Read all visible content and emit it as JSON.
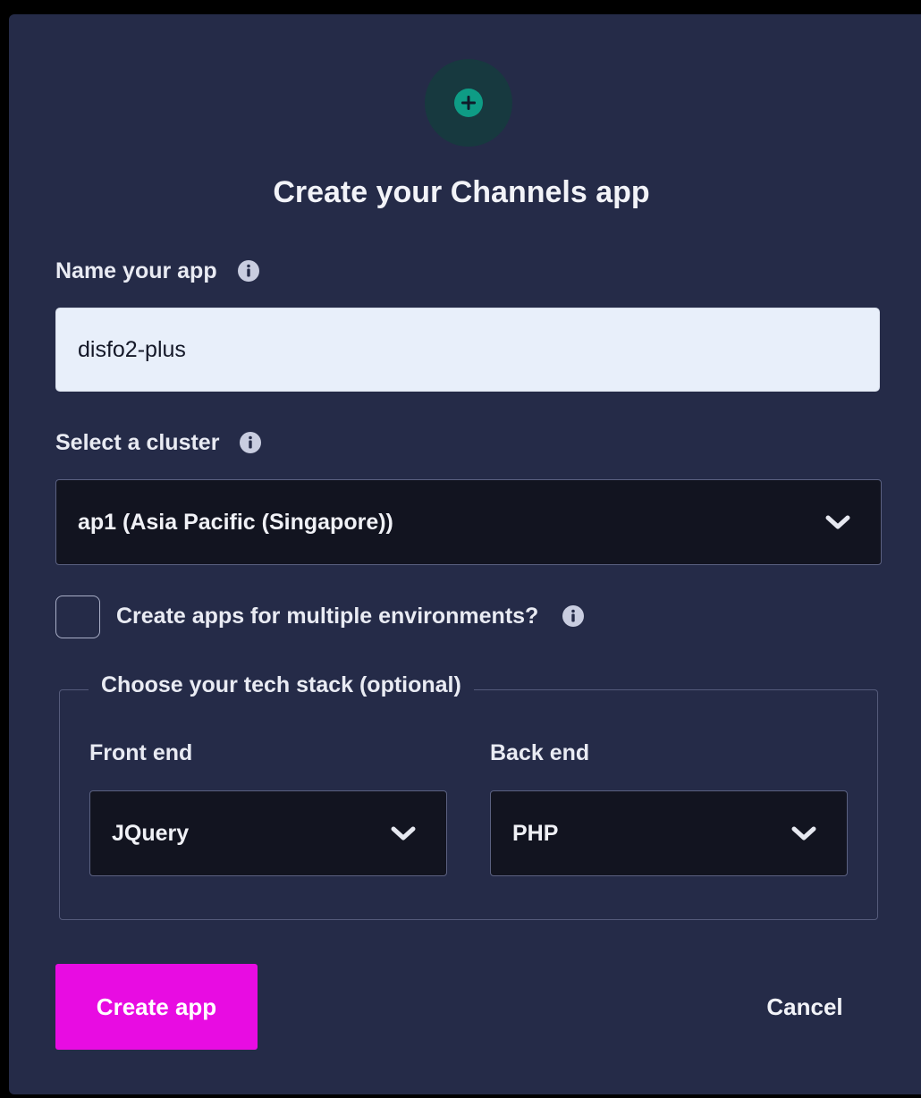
{
  "dialog": {
    "title": "Create your Channels app",
    "header_icon": "plus-circle-icon",
    "accent_color": "#0e9c85",
    "background_color": "#252b48"
  },
  "name_field": {
    "label": "Name your app",
    "value": "disfo2-plus",
    "info_icon": "info-icon"
  },
  "cluster_field": {
    "label": "Select a cluster",
    "selected": "ap1 (Asia Pacific (Singapore))",
    "info_icon": "info-icon"
  },
  "environments_checkbox": {
    "label": "Create apps for multiple environments?",
    "checked": false,
    "info_icon": "info-icon"
  },
  "tech_stack": {
    "legend": "Choose your tech stack (optional)",
    "front_end": {
      "label": "Front end",
      "selected": "JQuery"
    },
    "back_end": {
      "label": "Back end",
      "selected": "PHP"
    }
  },
  "actions": {
    "create_label": "Create app",
    "create_color": "#e80ce2",
    "cancel_label": "Cancel"
  }
}
